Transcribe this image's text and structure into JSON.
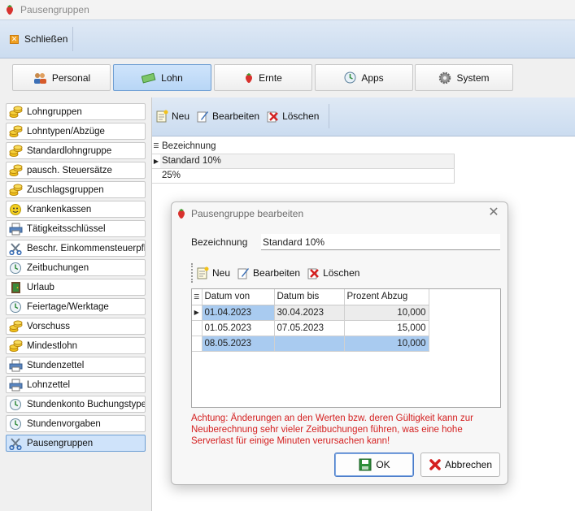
{
  "window": {
    "title": "Pausengruppen"
  },
  "ribbon": {
    "close_label": "Schließen"
  },
  "tabs": [
    {
      "label": "Personal",
      "icon": "people-icon"
    },
    {
      "label": "Lohn",
      "icon": "money-icon",
      "active": true
    },
    {
      "label": "Ernte",
      "icon": "strawberry-icon"
    },
    {
      "label": "Apps",
      "icon": "clock-icon"
    },
    {
      "label": "System",
      "icon": "gear-icon"
    }
  ],
  "sidebar": {
    "items": [
      {
        "label": "Lohngruppen",
        "icon": "coins-icon"
      },
      {
        "label": "Lohntypen/Abzüge",
        "icon": "coins-icon"
      },
      {
        "label": "Standardlohngruppe",
        "icon": "coins-icon"
      },
      {
        "label": "pausch. Steuersätze",
        "icon": "coins-icon"
      },
      {
        "label": "Zuschlagsgruppen",
        "icon": "coins-icon"
      },
      {
        "label": "Krankenkassen",
        "icon": "smiley-icon"
      },
      {
        "label": "Tätigkeitsschlüssel",
        "icon": "printer-icon"
      },
      {
        "label": "Beschr. Einkommensteuerpfl.",
        "icon": "scissors-icon"
      },
      {
        "label": "Zeitbuchungen",
        "icon": "clock-icon"
      },
      {
        "label": "Urlaub",
        "icon": "door-icon"
      },
      {
        "label": "Feiertage/Werktage",
        "icon": "clock-icon"
      },
      {
        "label": "Vorschuss",
        "icon": "coins-icon"
      },
      {
        "label": "Mindestlohn",
        "icon": "coins-icon"
      },
      {
        "label": "Stundenzettel",
        "icon": "printer-icon"
      },
      {
        "label": "Lohnzettel",
        "icon": "printer-icon"
      },
      {
        "label": "Stundenkonto Buchungstypen",
        "icon": "clock-icon"
      },
      {
        "label": "Stundenvorgaben",
        "icon": "clock-icon"
      },
      {
        "label": "Pausengruppen",
        "icon": "scissors-icon",
        "active": true
      }
    ]
  },
  "main": {
    "toolbar": {
      "new_label": "Neu",
      "edit_label": "Bearbeiten",
      "delete_label": "Löschen"
    },
    "grid": {
      "header": "Bezeichnung",
      "rows": [
        "Standard 10%",
        "25%"
      ]
    }
  },
  "dialog": {
    "title": "Pausengruppe bearbeiten",
    "name_label": "Bezeichnung",
    "name_value": "Standard 10%",
    "toolbar": {
      "new_label": "Neu",
      "edit_label": "Bearbeiten",
      "delete_label": "Löschen"
    },
    "grid": {
      "columns": [
        "Datum von",
        "Datum bis",
        "Prozent Abzug"
      ],
      "rows": [
        [
          "01.04.2023",
          "30.04.2023",
          "10,000"
        ],
        [
          "01.05.2023",
          "07.05.2023",
          "15,000"
        ],
        [
          "08.05.2023",
          "",
          "10,000"
        ]
      ]
    },
    "warning": "Achtung: Änderungen an den Werten bzw. deren Gültigkeit kann zur Neuberechnung sehr vieler Zeitbuchungen führen, was eine hohe Serverlast für einige Minuten verursachen kann!",
    "ok_label": "OK",
    "cancel_label": "Abbrechen"
  },
  "colors": {
    "accent_blue": "#cfe3fa",
    "ribbon_blue": "#cbdcf0",
    "warning_red": "#d42020",
    "selection_blue": "#a9cbf0"
  }
}
